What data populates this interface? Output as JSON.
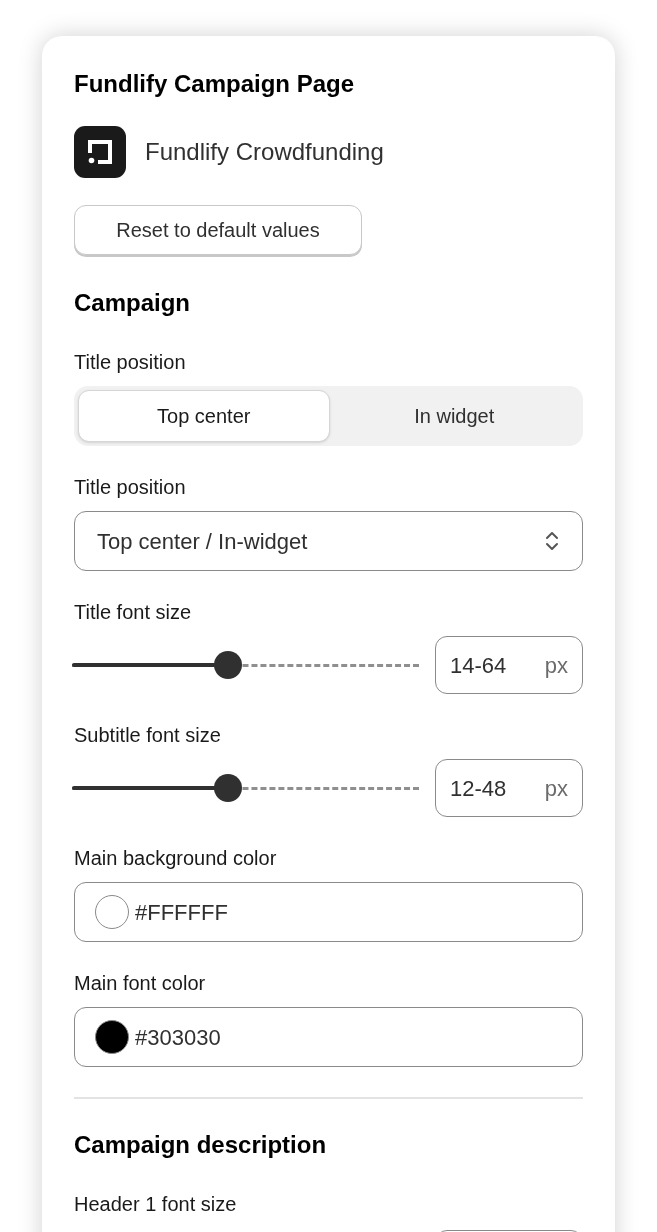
{
  "panel": {
    "title": "Fundlify Campaign Page",
    "brand": "Fundlify Crowdfunding",
    "reset_button": "Reset to default values"
  },
  "sections": [
    {
      "heading": "Campaign",
      "fields": [
        {
          "kind": "segmented",
          "label": "Title position",
          "options": [
            {
              "label": "Top center",
              "selected": true
            },
            {
              "label": "In widget",
              "selected": false
            }
          ]
        },
        {
          "kind": "select",
          "label": "Title position",
          "value": "Top center / In-widget"
        },
        {
          "kind": "slider",
          "label": "Title font size",
          "level": 0.45,
          "value": "14-64",
          "unit": "px"
        },
        {
          "kind": "slider",
          "label": "Subtitle font size",
          "level": 0.45,
          "value": "12-48",
          "unit": "px"
        },
        {
          "kind": "color",
          "label": "Main background color",
          "value": "#FFFFFF",
          "color": "#ffffff"
        },
        {
          "kind": "color",
          "label": "Main font color",
          "value": "#303030",
          "color": "#000000"
        }
      ]
    },
    {
      "heading": "Campaign description",
      "fields": [
        {
          "kind": "clipped",
          "label": "Header 1 font size"
        }
      ]
    }
  ]
}
